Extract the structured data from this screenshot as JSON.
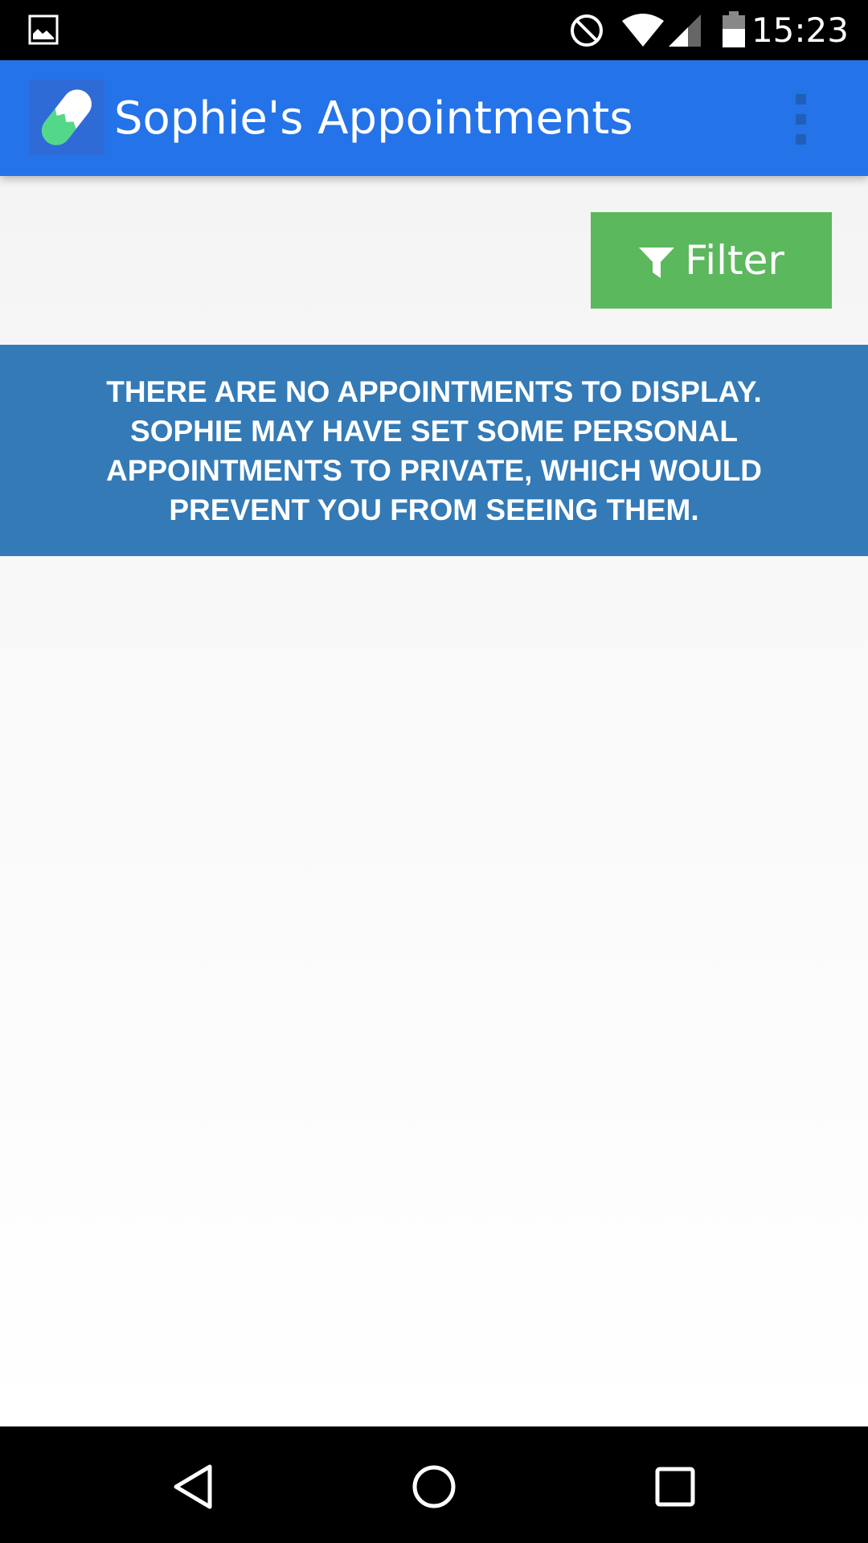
{
  "status_bar": {
    "time": "15:23",
    "icons": [
      "gallery-icon",
      "do-not-disturb-icon",
      "wifi-icon",
      "cell-signal-icon",
      "battery-icon"
    ]
  },
  "app_bar": {
    "title": "Sophie's Appointments",
    "logo_icon": "pill-logo-icon",
    "menu_icon": "overflow-menu-icon",
    "color": "#2573E8"
  },
  "filter": {
    "label": "Filter",
    "icon": "funnel-icon",
    "color": "#5CB85C"
  },
  "notice": {
    "message": "THERE ARE NO APPOINTMENTS TO DISPLAY. SOPHIE MAY HAVE SET SOME PERSONAL APPOINTMENTS TO PRIVATE, WHICH WOULD PREVENT YOU FROM SEEING THEM.",
    "color": "#337AB7"
  },
  "nav_bar": {
    "icons": [
      "back-icon",
      "home-icon",
      "recents-icon"
    ]
  }
}
